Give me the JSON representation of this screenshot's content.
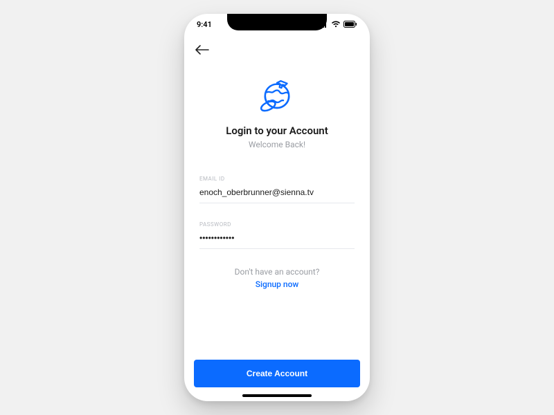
{
  "status": {
    "time": "9:41"
  },
  "header": {
    "title": "Login to your Account",
    "subtitle": "Welcome Back!"
  },
  "form": {
    "email": {
      "label": "EMAIL ID",
      "value": "enoch_oberbrunner@sienna.tv"
    },
    "password": {
      "label": "PASSWORD",
      "value": "••••••••••••"
    }
  },
  "signup": {
    "question": "Don't have an account?",
    "link": "Signup now"
  },
  "cta": {
    "label": "Create Account"
  },
  "colors": {
    "accent": "#0b6bff"
  }
}
